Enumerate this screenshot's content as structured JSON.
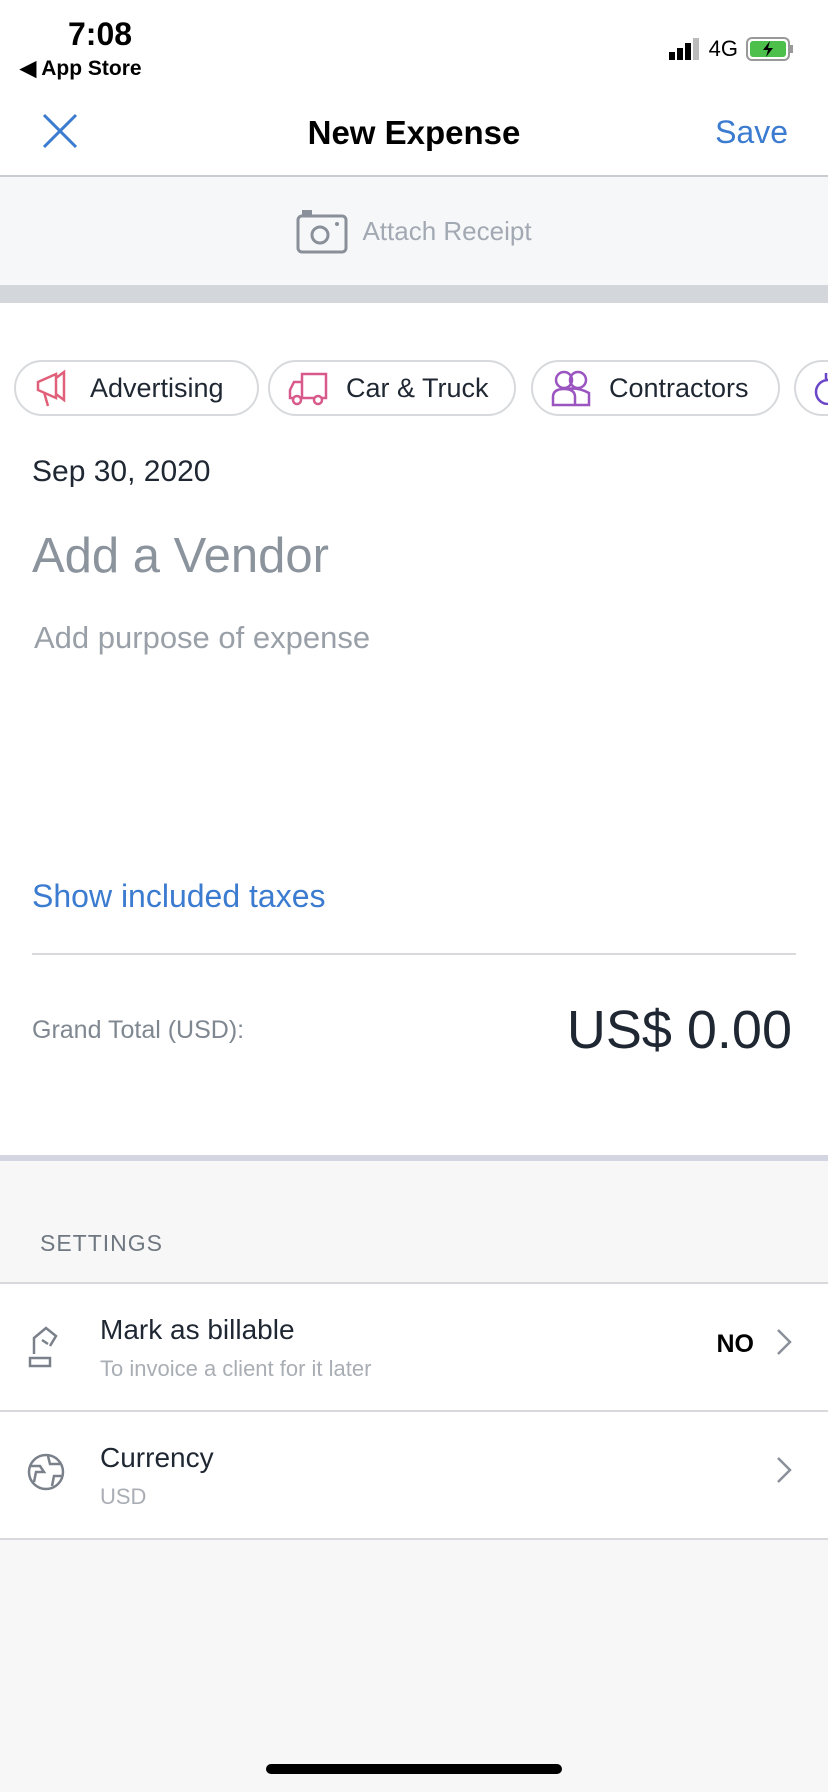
{
  "status_bar": {
    "time": "7:08",
    "back_app": "◀ App Store",
    "network": "4G"
  },
  "nav": {
    "title": "New Expense",
    "save_label": "Save",
    "close_icon": "close-icon"
  },
  "attach": {
    "label": "Attach Receipt",
    "icon": "camera-icon"
  },
  "categories": [
    {
      "label": "Advertising",
      "icon": "megaphone-icon",
      "color": "#e0607a"
    },
    {
      "label": "Car & Truck",
      "icon": "truck-icon",
      "color": "#d85a8a"
    },
    {
      "label": "Contractors",
      "icon": "people-icon",
      "color": "#9a55c0"
    },
    {
      "label": "",
      "icon": "category-icon",
      "color": "#6a45c8"
    }
  ],
  "form": {
    "date": "Sep 30, 2020",
    "vendor_placeholder": "Add a Vendor",
    "purpose_placeholder": "Add purpose of expense",
    "show_taxes": "Show included taxes",
    "grand_total_label": "Grand Total (USD):",
    "grand_total_value": "US$ 0.00"
  },
  "settings": {
    "header": "SETTINGS",
    "rows": [
      {
        "title": "Mark as billable",
        "subtitle": "To invoice a client for it later",
        "value": "NO",
        "icon": "billable-icon"
      },
      {
        "title": "Currency",
        "subtitle": "USD",
        "value": "",
        "icon": "globe-icon"
      }
    ]
  },
  "colors": {
    "accent": "#3b7bd0"
  }
}
